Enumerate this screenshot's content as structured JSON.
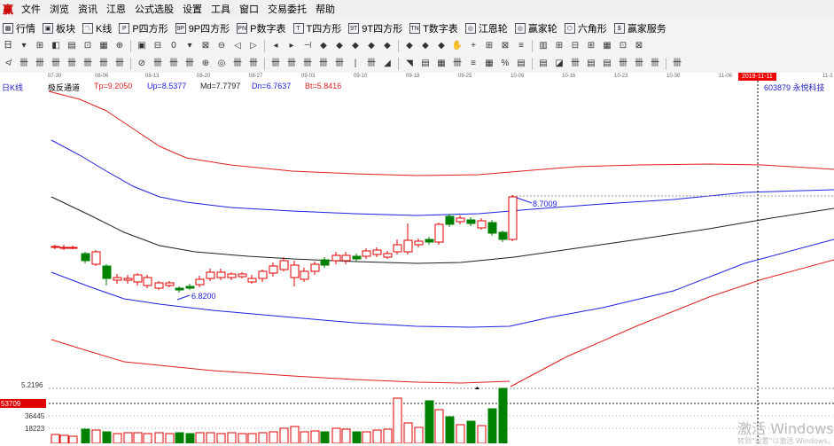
{
  "app": {
    "icon_glyph": "赢"
  },
  "menu": [
    "文件",
    "浏览",
    "资讯",
    "江恩",
    "公式选股",
    "设置",
    "工具",
    "窗口",
    "交易委托",
    "帮助"
  ],
  "toolbar1": [
    {
      "label": "行情",
      "icon": "grid-icon",
      "glyph": "▦"
    },
    {
      "label": "板块",
      "icon": "sector-icon",
      "glyph": "▣"
    },
    {
      "label": "K线",
      "icon": "kline-icon",
      "glyph": "〽"
    },
    {
      "label": "P四方形",
      "icon": "p-square-icon",
      "glyph": "P"
    },
    {
      "label": "9P四方形",
      "icon": "9p-square-icon",
      "glyph": "9P"
    },
    {
      "label": "P数字表",
      "icon": "p-number-table-icon",
      "glyph": "PN"
    },
    {
      "label": "T四方形",
      "icon": "t-square-icon",
      "glyph": "T"
    },
    {
      "label": "9T四方形",
      "icon": "9t-square-icon",
      "glyph": "9T"
    },
    {
      "label": "T数字表",
      "icon": "t-number-table-icon",
      "glyph": "TN"
    },
    {
      "label": "江恩轮",
      "icon": "gann-wheel-icon",
      "glyph": "◎"
    },
    {
      "label": "赢家轮",
      "icon": "winner-wheel-icon",
      "glyph": "◎"
    },
    {
      "label": "六角形",
      "icon": "hexagon-icon",
      "glyph": "⬡"
    },
    {
      "label": "赢家服务",
      "icon": "dollar-icon",
      "glyph": "$"
    }
  ],
  "toolbar2_glyphs": [
    "日",
    "▾",
    "⊞",
    "◧",
    "▤",
    "⊡",
    "▦",
    "⊕",
    "▣",
    "⊟",
    "0",
    "▾",
    "⊠",
    "⊖",
    "◁",
    "▷",
    "◂",
    "▸",
    "⊣",
    "◆",
    "◆",
    "◆",
    "◆",
    "◆",
    "◆",
    "◆",
    "◆",
    "✋",
    "+",
    "⊞",
    "⊠",
    "≡",
    "▥",
    "⊞",
    "⊟",
    "⊞",
    "▦",
    "⊡",
    "⊠"
  ],
  "toolbar3_glyphs": [
    "≮",
    "卌",
    "卌",
    "卌",
    "卌",
    "卌",
    "卌",
    "卌",
    "⊘",
    "卌",
    "卌",
    "卌",
    "⊕",
    "◎",
    "卌",
    "卌",
    "卌",
    "卌",
    "卌",
    "卌",
    "卌",
    "|",
    "卌",
    "◢",
    "◥",
    "▤",
    "▦",
    "卌",
    "≡",
    "▦",
    "%",
    "▤",
    "▤",
    "◪",
    "卌",
    "▤",
    "▤",
    "卌",
    "卌",
    "卌",
    "卌"
  ],
  "date_axis": {
    "ticks": [
      "07-30",
      "08-06",
      "08-13",
      "08-20",
      "08-27",
      "09-03",
      "09-10",
      "09-18",
      "09-25",
      "10-09",
      "10-16",
      "10-23",
      "10-30",
      "11-06",
      "2019-11-11",
      "11-2"
    ]
  },
  "indicator": {
    "period_label": "日K线",
    "name": "极反通道",
    "tp": "Tp=9.2050",
    "up": "Up=8.5377",
    "md": "Md=7.7797",
    "dn": "Dn=6.7637",
    "bt": "Bt=5.8416",
    "stock": "603879  永悦科技"
  },
  "annotations": {
    "high": "8.7009",
    "low": "6.8200"
  },
  "volume": {
    "top_label": "5.2196",
    "highlight": "53709",
    "mid_label": "36445",
    "low_label": "18223"
  },
  "colors": {
    "tp": "#e02020",
    "up": "#2020e0",
    "md": "#202020",
    "dn": "#2020e0",
    "bt": "#e02020",
    "up_candle": "#e00000",
    "down_candle": "#008000",
    "highlight": "#e00000"
  },
  "watermark": {
    "line1": "激活 Windows",
    "line2": "转到\"设置\"以激活 Windows。"
  }
}
